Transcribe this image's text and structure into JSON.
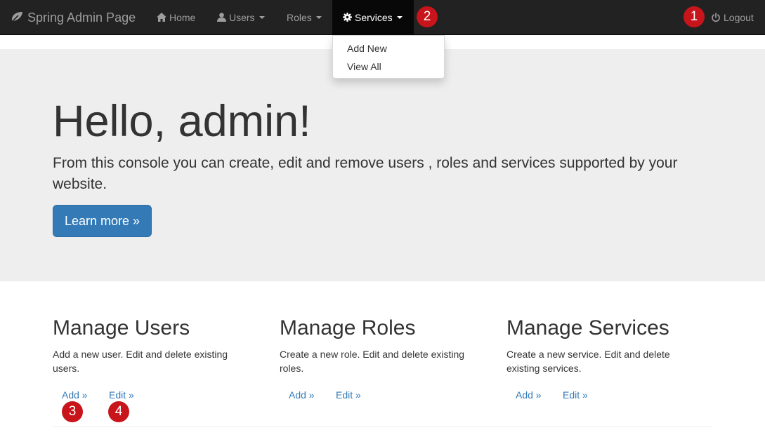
{
  "navbar": {
    "brand": "Spring Admin Page",
    "home": "Home",
    "users": "Users",
    "roles": "Roles",
    "services": "Services",
    "logout": "Logout"
  },
  "services_menu": {
    "items": [
      "Add New",
      "View All"
    ]
  },
  "badges": [
    "1",
    "2",
    "3",
    "4"
  ],
  "hero": {
    "title": "Hello, admin!",
    "text": "From this console you can create, edit and remove users , roles and services supported by your website.",
    "button": "Learn more »"
  },
  "sections": [
    {
      "title": "Manage Users",
      "text": "Add a new user. Edit and delete existing users.",
      "add": "Add »",
      "edit": "Edit »"
    },
    {
      "title": "Manage Roles",
      "text": "Create a new role. Edit and delete existing roles.",
      "add": "Add »",
      "edit": "Edit »"
    },
    {
      "title": "Manage Services",
      "text": "Create a new service. Edit and delete existing services.",
      "add": "Add »",
      "edit": "Edit »"
    }
  ],
  "colors": {
    "navbar": "#222222",
    "badge": "#c8141b",
    "primary": "#337ab7",
    "jumbotron": "#eeeeee"
  }
}
